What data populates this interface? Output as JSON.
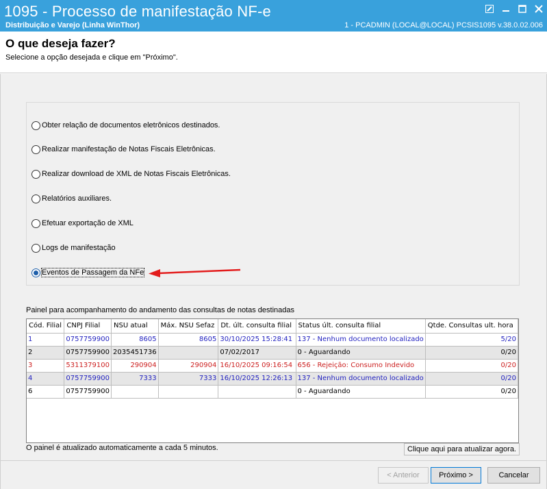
{
  "window": {
    "title": "1095 - Processo de manifestação NF-e",
    "subtitle": "Distribuição e Varejo (Linha WinThor)",
    "info": "1 - PCADMIN (LOCAL@LOCAL)   PCSIS1095  v.38.0.02.006"
  },
  "header": {
    "title": "O que deseja fazer?",
    "subtitle": "Selecione a opção desejada e clique em \"Próximo\"."
  },
  "options": [
    {
      "label": "Obter relação de documentos eletrônicos destinados.",
      "selected": false
    },
    {
      "label": "Realizar manifestação de Notas Fiscais Eletrônicas.",
      "selected": false
    },
    {
      "label": "Realizar download de XML de Notas Fiscais Eletrônicas.",
      "selected": false
    },
    {
      "label": "Relatórios auxiliares.",
      "selected": false
    },
    {
      "label": "Efetuar exportação de XML",
      "selected": false
    },
    {
      "label": "Logs de manifestação",
      "selected": false
    },
    {
      "label": "Eventos de Passagem da NFe",
      "selected": true
    }
  ],
  "panel": {
    "title": "Painel para acompanhamento do andamento das consultas de notas destinadas",
    "columns": [
      "Cód. Filial",
      "CNPJ Filial",
      "NSU atual",
      "Máx. NSU Sefaz",
      "Dt. últ. consulta filial",
      "Status últ. consulta filial",
      "Qtde. Consultas ult. hora"
    ],
    "rows": [
      [
        "1",
        "0757759900",
        "8605",
        "8605",
        "30/10/2025 15:28:41",
        "137 - Nenhum documento localizado",
        "5/20"
      ],
      [
        "2",
        "0757759900",
        "2035451736",
        "",
        "07/02/2017",
        "0 - Aguardando",
        "0/20"
      ],
      [
        "3",
        "5311379100",
        "290904",
        "290904",
        "16/10/2025 09:16:54",
        "656 - Rejeição: Consumo Indevido",
        "0/20"
      ],
      [
        "4",
        "0757759900",
        "7333",
        "7333",
        "16/10/2025 12:26:13",
        "137 - Nenhum documento localizado",
        "0/20"
      ],
      [
        "6",
        "0757759900",
        "",
        "",
        "",
        "0 - Aguardando",
        "0/20"
      ]
    ],
    "row_colors": [
      "#1f1fbf",
      "#000000",
      "#cc1f1f",
      "#1f1fbf",
      "#000000"
    ],
    "note": "O painel é atualizado automaticamente a cada 5 minutos.",
    "refresh_label": "Clique aqui para atualizar agora."
  },
  "buttons": {
    "back": "< Anterior",
    "next": "Próximo >",
    "cancel": "Cancelar"
  },
  "colors": {
    "titlebar": "#39a1dc",
    "arrow": "#e31c1c",
    "radio_selected": "#1e5faa"
  }
}
